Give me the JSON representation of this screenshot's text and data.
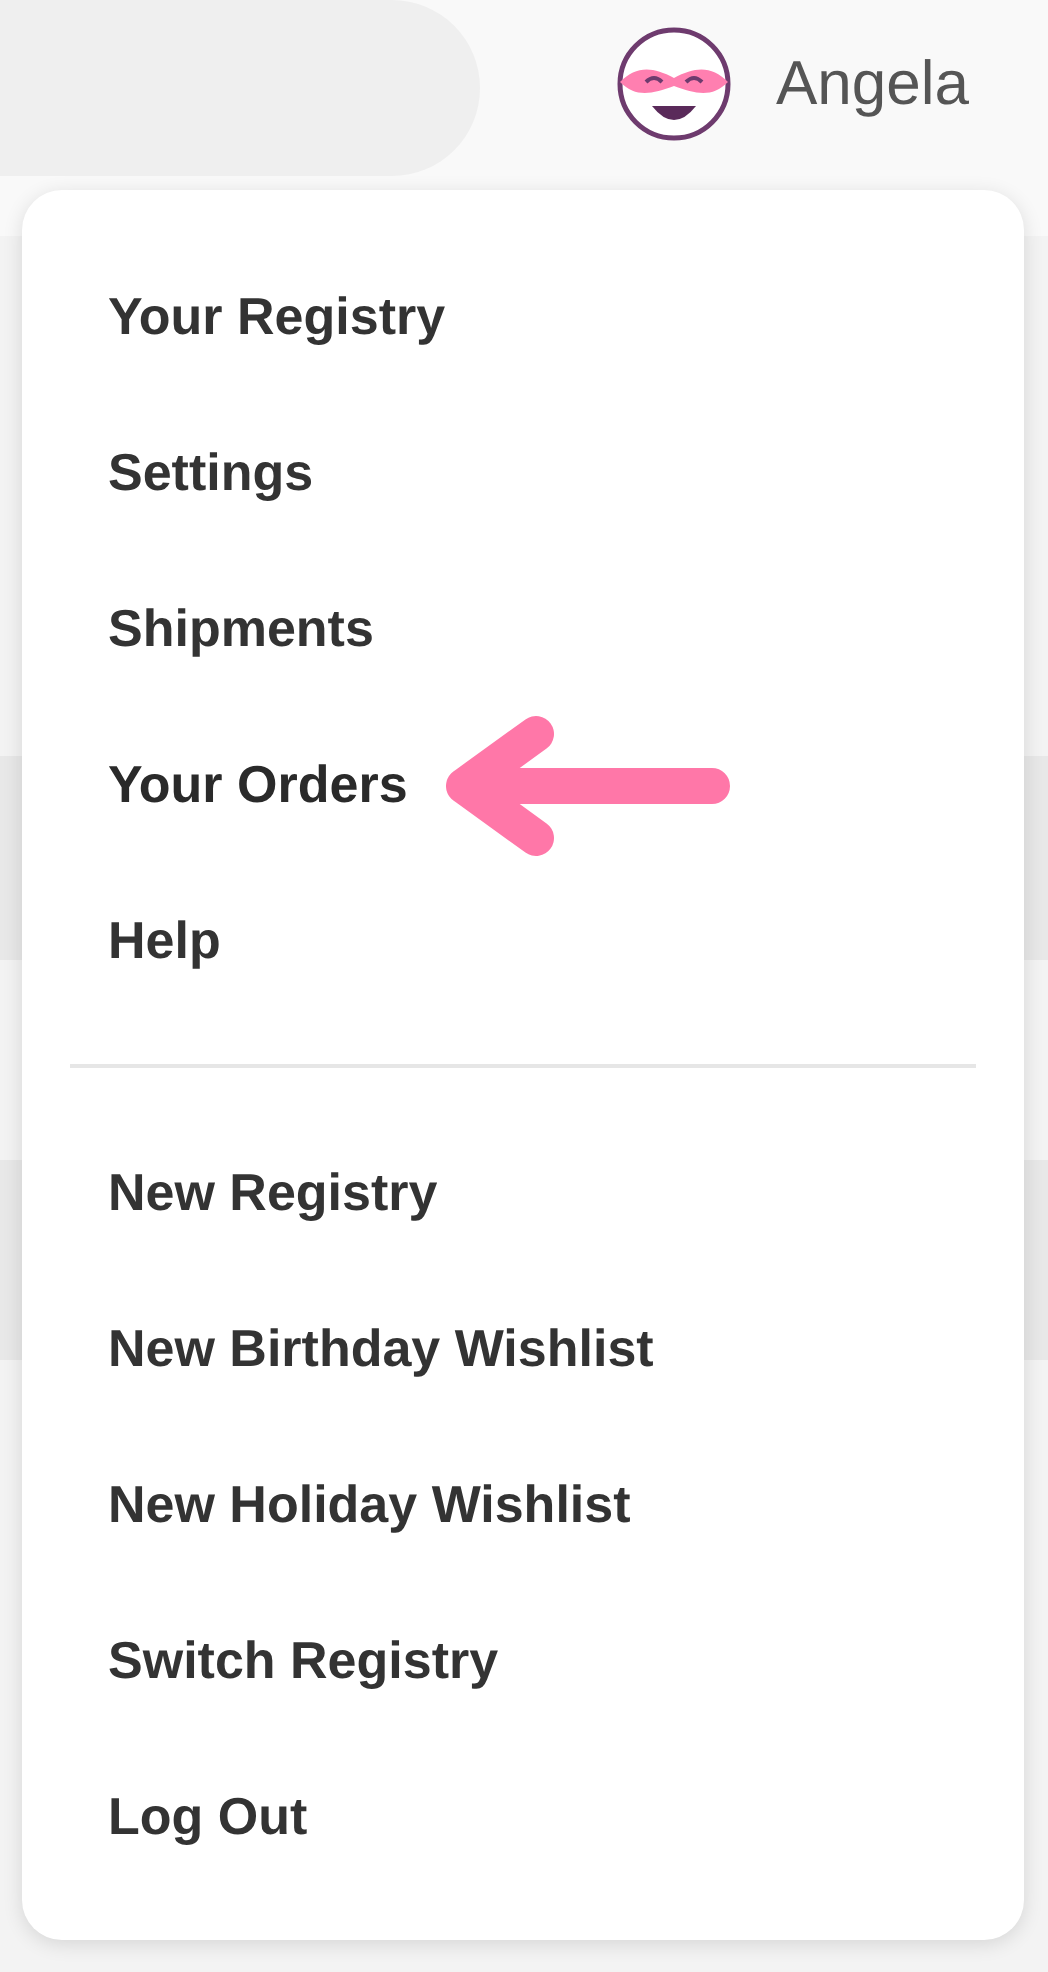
{
  "header": {
    "user_name": "Angela"
  },
  "menu": {
    "groups": [
      {
        "items": [
          {
            "label": "Your Registry",
            "highlighted": false
          },
          {
            "label": "Settings",
            "highlighted": false
          },
          {
            "label": "Shipments",
            "highlighted": false
          },
          {
            "label": "Your Orders",
            "highlighted": true
          },
          {
            "label": "Help",
            "highlighted": false
          }
        ]
      },
      {
        "items": [
          {
            "label": "New Registry",
            "highlighted": false
          },
          {
            "label": "New Birthday Wishlist",
            "highlighted": false
          },
          {
            "label": "New Holiday Wishlist",
            "highlighted": false
          },
          {
            "label": "Switch Registry",
            "highlighted": false
          },
          {
            "label": "Log Out",
            "highlighted": false
          }
        ]
      }
    ]
  }
}
